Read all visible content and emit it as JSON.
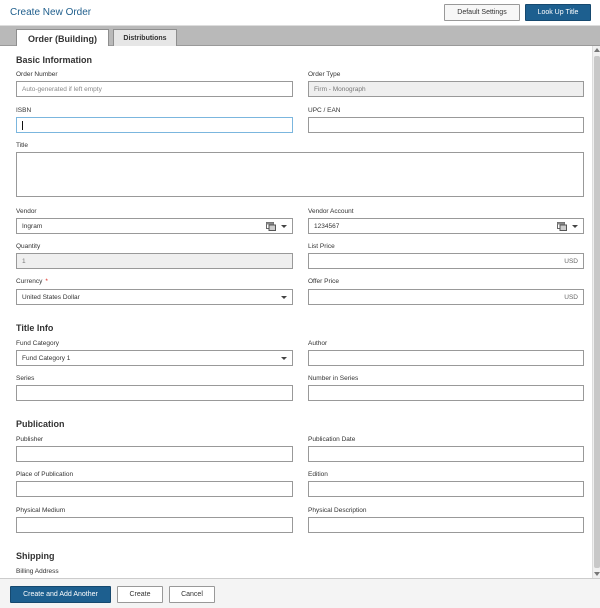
{
  "header": {
    "title": "Create New Order",
    "default_settings_label": "Default Settings",
    "lookup_label": "Look Up Title"
  },
  "tabs": [
    {
      "label": "Order (Building)",
      "active": true
    },
    {
      "label": "Distributions",
      "active": false
    }
  ],
  "basic_info": {
    "title": "Basic Information",
    "order_number": {
      "label": "Order Number",
      "placeholder": "Auto-generated if left empty"
    },
    "order_type": {
      "label": "Order Type",
      "value": "Firm - Monograph"
    },
    "isbn": {
      "label": "ISBN",
      "value": ""
    },
    "upc": {
      "label": "UPC / EAN",
      "value": ""
    },
    "title_field": {
      "label": "Title",
      "value": ""
    },
    "vendor": {
      "label": "Vendor",
      "value": "Ingram"
    },
    "vendor_account": {
      "label": "Vendor Account",
      "value": "1234567"
    },
    "quantity": {
      "label": "Quantity",
      "value": "1"
    },
    "list_price": {
      "label": "List Price",
      "value": "",
      "currency_suffix": "USD"
    },
    "currency": {
      "label": "Currency",
      "required_marker": "*",
      "value": "United States Dollar"
    },
    "offer_price": {
      "label": "Offer Price",
      "value": "",
      "currency_suffix": "USD"
    }
  },
  "title_info": {
    "title": "Title Info",
    "fund_category": {
      "label": "Fund Category",
      "value": "Fund Category 1"
    },
    "author": {
      "label": "Author",
      "value": ""
    },
    "series": {
      "label": "Series",
      "value": ""
    },
    "number_in_series": {
      "label": "Number in Series",
      "value": ""
    }
  },
  "publication": {
    "title": "Publication",
    "publisher": {
      "label": "Publisher",
      "value": ""
    },
    "publication_date": {
      "label": "Publication Date",
      "value": ""
    },
    "place": {
      "label": "Place of Publication",
      "value": ""
    },
    "edition": {
      "label": "Edition",
      "value": ""
    },
    "physical_medium": {
      "label": "Physical Medium",
      "value": ""
    },
    "physical_description": {
      "label": "Physical Description",
      "value": ""
    }
  },
  "shipping": {
    "title": "Shipping",
    "billing_address": {
      "label": "Billing Address"
    }
  },
  "footer": {
    "create_add_label": "Create and Add Another",
    "create_label": "Create",
    "cancel_label": "Cancel"
  },
  "colors": {
    "accent": "#1d5f8f",
    "title_blue": "#1f5e8c",
    "required_red": "#d9261c",
    "focus_border": "#7bb6de"
  },
  "icons": {
    "lookup_icon": "table-lookup-icon",
    "dropdown_icon": "chevron-down-icon"
  }
}
